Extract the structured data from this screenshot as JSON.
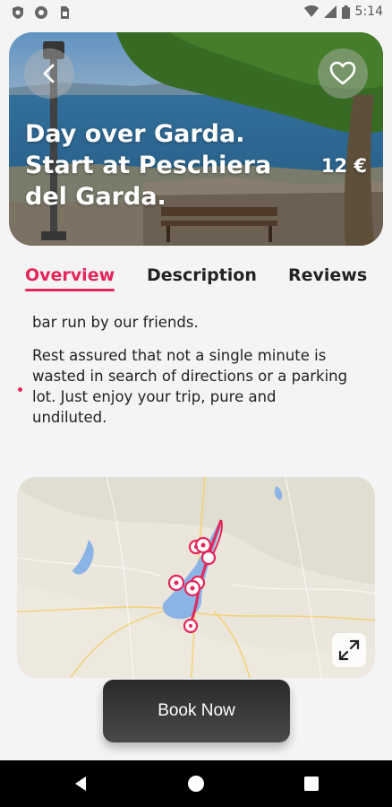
{
  "status_bar": {
    "time": "5:14"
  },
  "hero": {
    "title": "Day over Garda. Start at Peschiera del Garda.",
    "price": "12 €"
  },
  "tabs": [
    {
      "label": "Overview",
      "active": true
    },
    {
      "label": "Description",
      "active": false
    },
    {
      "label": "Reviews",
      "active": false
    }
  ],
  "content": {
    "paragraph_1": "bar run by our friends.",
    "paragraph_2": "Rest assured that not a single minute is wasted in search of directions or a parking lot. Just enjoy your trip, pure and undiluted."
  },
  "book_button": {
    "label": "Book Now"
  },
  "colors": {
    "accent": "#e5265a",
    "button": "#333333"
  }
}
